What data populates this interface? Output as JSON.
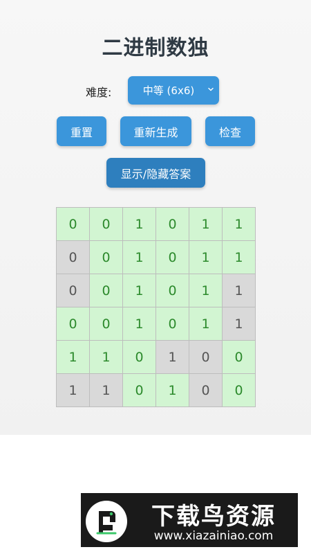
{
  "title": "二进制数独",
  "difficulty": {
    "label": "难度:",
    "selected": "中等 (6x6)"
  },
  "buttons": {
    "reset": "重置",
    "regenerate": "重新生成",
    "check": "检查",
    "toggle_answer": "显示/隐藏答案"
  },
  "board": {
    "size": 6,
    "cells": [
      [
        {
          "v": "0",
          "fixed": false
        },
        {
          "v": "0",
          "fixed": false
        },
        {
          "v": "1",
          "fixed": false
        },
        {
          "v": "0",
          "fixed": false
        },
        {
          "v": "1",
          "fixed": false
        },
        {
          "v": "1",
          "fixed": false
        }
      ],
      [
        {
          "v": "0",
          "fixed": true
        },
        {
          "v": "0",
          "fixed": false
        },
        {
          "v": "1",
          "fixed": false
        },
        {
          "v": "0",
          "fixed": false
        },
        {
          "v": "1",
          "fixed": false
        },
        {
          "v": "1",
          "fixed": false
        }
      ],
      [
        {
          "v": "0",
          "fixed": true
        },
        {
          "v": "0",
          "fixed": false
        },
        {
          "v": "1",
          "fixed": false
        },
        {
          "v": "0",
          "fixed": false
        },
        {
          "v": "1",
          "fixed": false
        },
        {
          "v": "1",
          "fixed": true
        }
      ],
      [
        {
          "v": "0",
          "fixed": false
        },
        {
          "v": "0",
          "fixed": false
        },
        {
          "v": "1",
          "fixed": false
        },
        {
          "v": "0",
          "fixed": false
        },
        {
          "v": "1",
          "fixed": false
        },
        {
          "v": "1",
          "fixed": true
        }
      ],
      [
        {
          "v": "1",
          "fixed": false
        },
        {
          "v": "1",
          "fixed": false
        },
        {
          "v": "0",
          "fixed": false
        },
        {
          "v": "1",
          "fixed": true
        },
        {
          "v": "0",
          "fixed": true
        },
        {
          "v": "0",
          "fixed": false
        }
      ],
      [
        {
          "v": "1",
          "fixed": true
        },
        {
          "v": "1",
          "fixed": true
        },
        {
          "v": "0",
          "fixed": false
        },
        {
          "v": "1",
          "fixed": false
        },
        {
          "v": "0",
          "fixed": true
        },
        {
          "v": "0",
          "fixed": false
        }
      ]
    ]
  },
  "colors": {
    "accent": "#3b96db",
    "user_cell_bg": "#d2f5d2",
    "user_cell_text": "#2c8a2c",
    "fixed_cell_bg": "#d9d9d9",
    "fixed_cell_text": "#555555"
  },
  "watermark": {
    "title": "下载鸟资源",
    "url": "www.xiazainiao.com"
  }
}
